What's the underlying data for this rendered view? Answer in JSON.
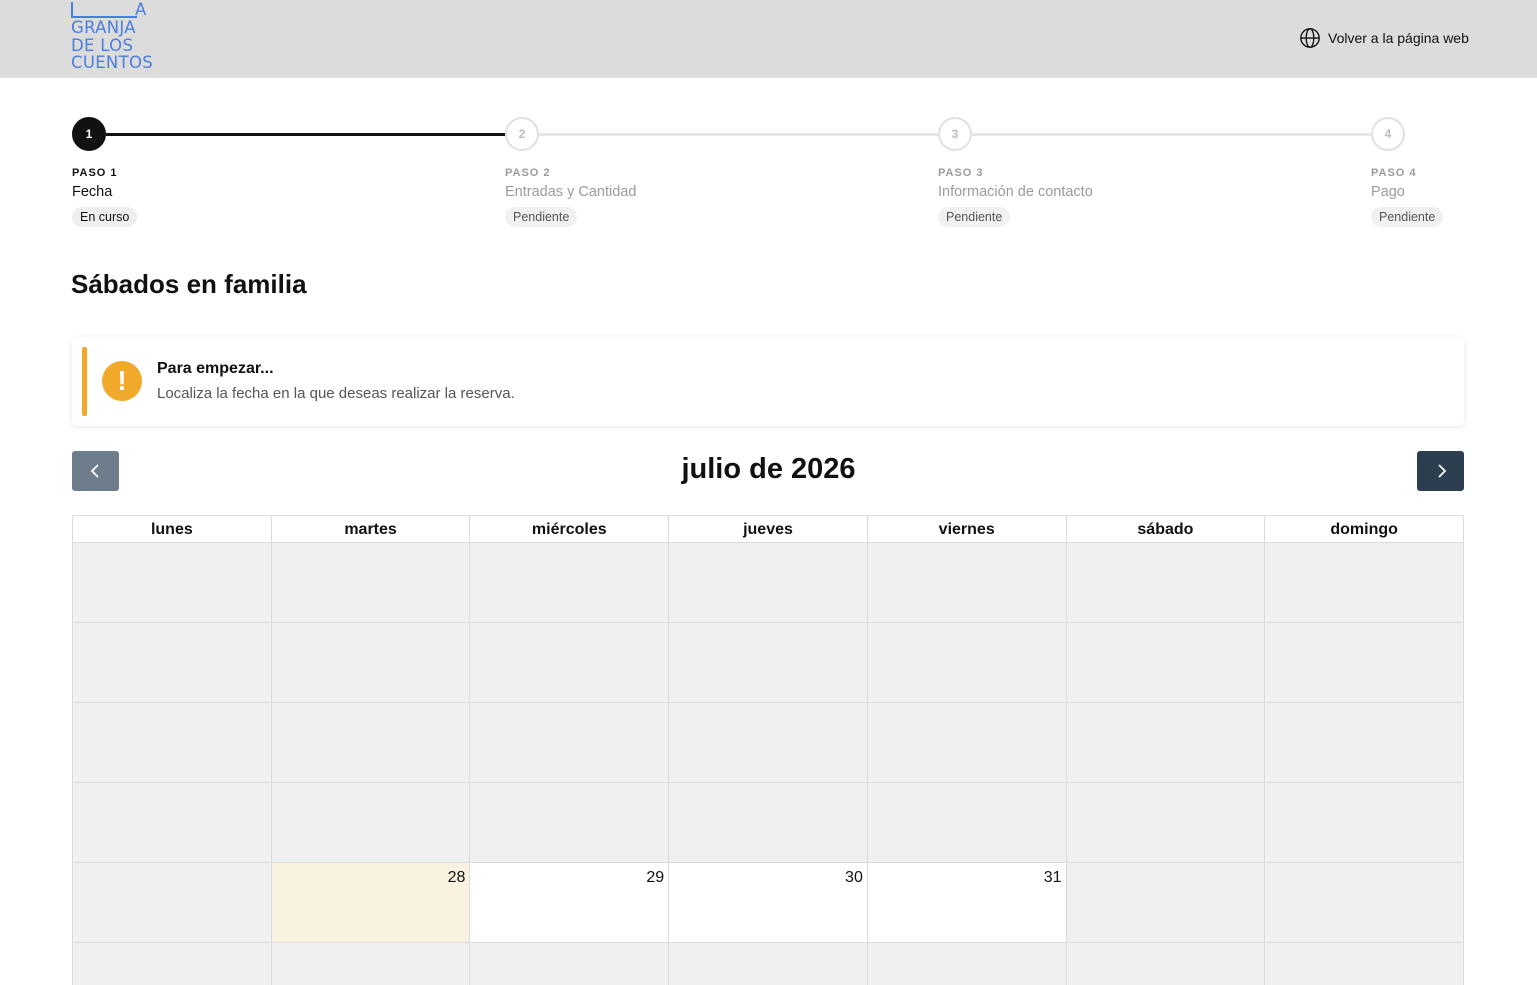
{
  "header": {
    "logo_lines": [
      "A",
      "GRANJA",
      "DE LOS",
      "CUENTOS"
    ],
    "back_link": "Volver a la página web",
    "back_icon": "globe-icon"
  },
  "stepper": {
    "steps": [
      {
        "number": "1",
        "kicker": "PASO 1",
        "name": "Fecha",
        "badge": "En curso",
        "state": "active"
      },
      {
        "number": "2",
        "kicker": "PASO 2",
        "name": "Entradas y Cantidad",
        "badge": "Pendiente",
        "state": "pending"
      },
      {
        "number": "3",
        "kicker": "PASO 3",
        "name": "Información de contacto",
        "badge": "Pendiente",
        "state": "pending"
      },
      {
        "number": "4",
        "kicker": "PASO 4",
        "name": "Pago",
        "badge": "Pendiente",
        "state": "pending"
      }
    ]
  },
  "page": {
    "title": "Sábados en familia"
  },
  "notice": {
    "icon": "!",
    "title": "Para empezar...",
    "text": "Localiza la fecha en la que deseas realizar la reserva.",
    "accent_color": "#f0a92a"
  },
  "calendar": {
    "month_title": "julio de 2026",
    "prev_icon": "chevron-left-icon",
    "next_icon": "chevron-right-icon",
    "weekdays": [
      "lunes",
      "martes",
      "miércoles",
      "jueves",
      "viernes",
      "sábado",
      "domingo"
    ],
    "weeks": [
      [
        {
          "n": ""
        },
        {
          "n": ""
        },
        {
          "n": ""
        },
        {
          "n": ""
        },
        {
          "n": ""
        },
        {
          "n": ""
        },
        {
          "n": ""
        }
      ],
      [
        {
          "n": ""
        },
        {
          "n": ""
        },
        {
          "n": ""
        },
        {
          "n": ""
        },
        {
          "n": ""
        },
        {
          "n": ""
        },
        {
          "n": ""
        }
      ],
      [
        {
          "n": ""
        },
        {
          "n": ""
        },
        {
          "n": ""
        },
        {
          "n": ""
        },
        {
          "n": ""
        },
        {
          "n": ""
        },
        {
          "n": ""
        }
      ],
      [
        {
          "n": ""
        },
        {
          "n": ""
        },
        {
          "n": ""
        },
        {
          "n": ""
        },
        {
          "n": ""
        },
        {
          "n": ""
        },
        {
          "n": ""
        }
      ],
      [
        {
          "n": ""
        },
        {
          "n": "28",
          "today": true
        },
        {
          "n": "29",
          "available": true
        },
        {
          "n": "30",
          "available": true
        },
        {
          "n": "31",
          "available": true
        },
        {
          "n": ""
        },
        {
          "n": ""
        }
      ],
      [
        {
          "n": ""
        },
        {
          "n": ""
        },
        {
          "n": ""
        },
        {
          "n": ""
        },
        {
          "n": ""
        },
        {
          "n": ""
        },
        {
          "n": ""
        }
      ]
    ],
    "colors": {
      "disabled": "#f0f0f0",
      "today": "#faf2e1",
      "available": "#ffffff",
      "next_button": "#2c3e50",
      "prev_button": "#6e7d8b"
    }
  }
}
